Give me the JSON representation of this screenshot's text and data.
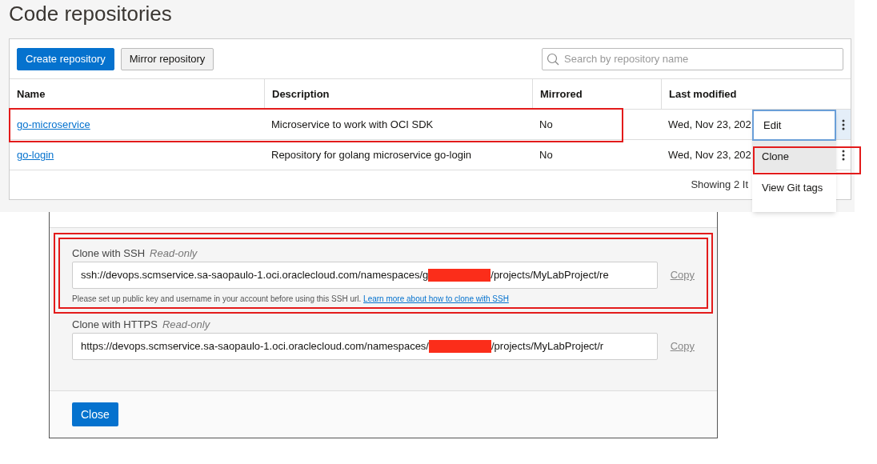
{
  "page": {
    "title": "Code repositories"
  },
  "toolbar": {
    "buttons": [
      {
        "label": "Create repository",
        "kind": "primary"
      },
      {
        "label": "Mirror repository",
        "kind": "secondary"
      }
    ],
    "search": {
      "placeholder": "Search by repository name"
    }
  },
  "table": {
    "columns": [
      "Name",
      "Description",
      "Mirrored",
      "Last modified"
    ],
    "rows": [
      {
        "name": "go-microservice",
        "description": "Microservice to work with OCI SDK",
        "mirrored": "No",
        "last_modified": "Wed, Nov 23, 202",
        "highlighted": true,
        "menu_open": true
      },
      {
        "name": "go-login",
        "description": "Repository for golang microservice go-login",
        "mirrored": "No",
        "last_modified": "Wed, Nov 23, 202",
        "highlighted": false,
        "menu_open": false
      }
    ],
    "footer": "Showing 2 It"
  },
  "action_menu": {
    "items": [
      {
        "label": "Edit",
        "focused": true,
        "hovered": false,
        "highlighted": false
      },
      {
        "label": "Clone",
        "focused": false,
        "hovered": true,
        "highlighted": true
      },
      {
        "label": "View Git tags",
        "focused": false,
        "hovered": false,
        "highlighted": false
      }
    ]
  },
  "clone_dialog": {
    "sections": [
      {
        "label": "Clone with SSH",
        "note": "Read-only",
        "value_before": "ssh://devops.scmservice.sa-saopaulo-1.oci.oraclecloud.com/namespaces/g",
        "redacted": true,
        "value_after": "/projects/MyLabProject/re",
        "copy": "Copy",
        "hint": "Please set up public key and username in your account before using this SSH url.",
        "hint_link": "Learn more about how to clone with SSH",
        "highlighted": true
      },
      {
        "label": "Clone with HTTPS",
        "note": "Read-only",
        "value_before": "https://devops.scmservice.sa-saopaulo-1.oci.oraclecloud.com/namespaces/",
        "redacted": true,
        "value_after": "/projects/MyLabProject/r",
        "copy": "Copy",
        "highlighted": false
      }
    ],
    "close_button": "Close"
  }
}
